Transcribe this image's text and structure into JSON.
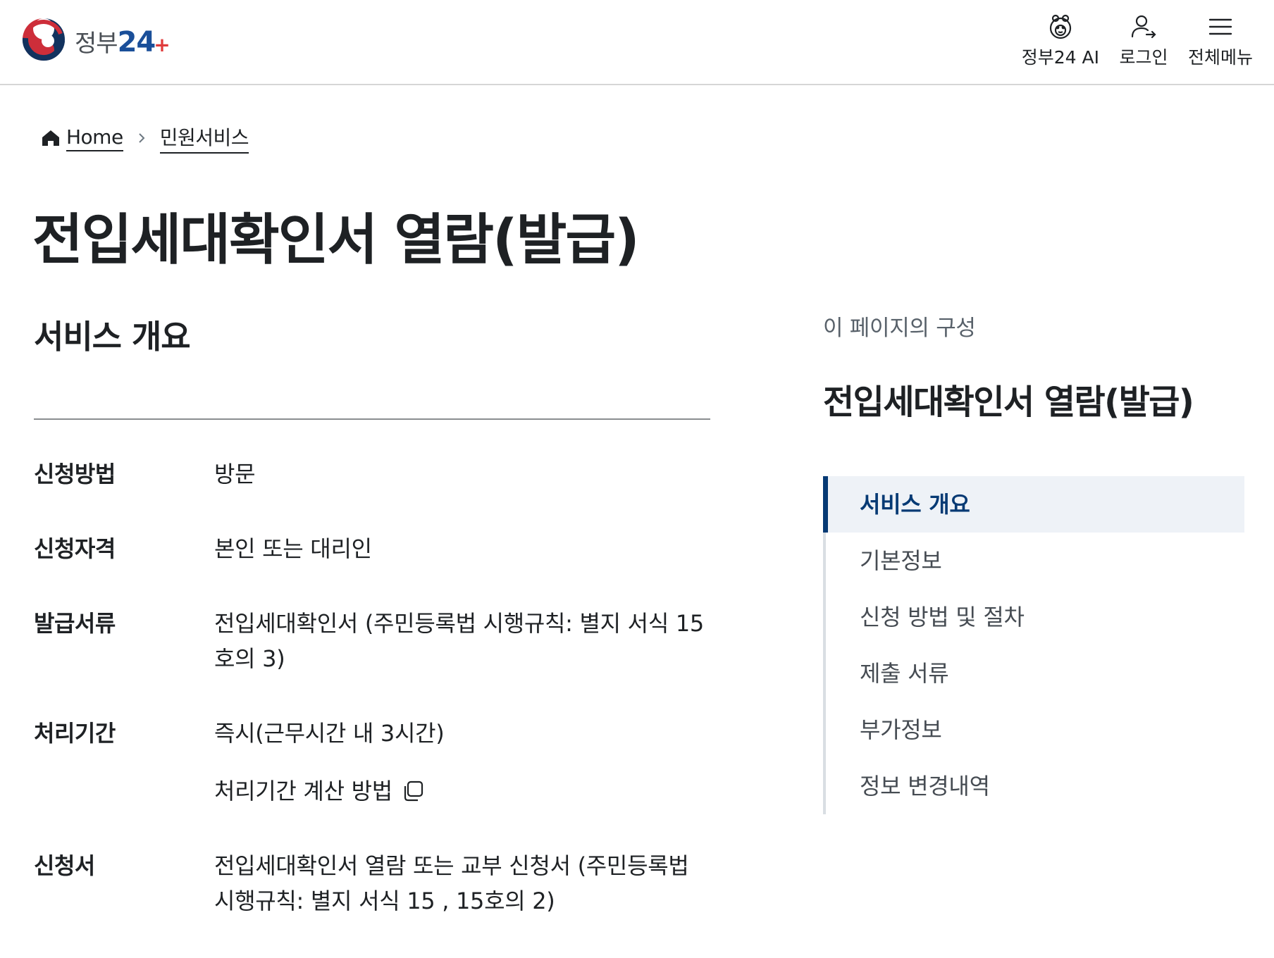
{
  "header": {
    "logo_text": "정부",
    "logo_number": "24",
    "logo_plus": "+",
    "nav": [
      {
        "label": "정부24 AI",
        "icon": "ai-mascot-icon"
      },
      {
        "label": "로그인",
        "icon": "login-user-icon"
      },
      {
        "label": "전체메뉴",
        "icon": "hamburger-menu-icon"
      }
    ]
  },
  "breadcrumb": {
    "home": "Home",
    "current": "민원서비스"
  },
  "page_title": "전입세대확인서 열람(발급)",
  "overview": {
    "section_title": "서비스 개요",
    "rows": [
      {
        "label": "신청방법",
        "value": "방문"
      },
      {
        "label": "신청자격",
        "value": "본인 또는 대리인"
      },
      {
        "label": "발급서류",
        "value": "전입세대확인서 (주민등록법 시행규칙: 별지 서식 15호의 3)"
      },
      {
        "label": "처리기간",
        "value": "즉시(근무시간 내 3시간)",
        "link": "처리기간 계산 방법"
      },
      {
        "label": "신청서",
        "value": "전입세대확인서 열람 또는 교부 신청서 (주민등록법 시행규칙: 별지 서식 15 , 15호의 2)"
      }
    ]
  },
  "toc": {
    "caption": "이 페이지의 구성",
    "title": "전입세대확인서 열람(발급)",
    "items": [
      {
        "label": "서비스 개요",
        "active": true
      },
      {
        "label": "기본정보",
        "active": false
      },
      {
        "label": "신청 방법 및 절차",
        "active": false
      },
      {
        "label": "제출 서류",
        "active": false
      },
      {
        "label": "부가정보",
        "active": false
      },
      {
        "label": "정보 변경내역",
        "active": false
      }
    ]
  },
  "colors": {
    "primary_navy": "#063a74",
    "toc_active_bg": "#eef2f7",
    "logo_blue": "#1a4f99",
    "logo_red": "#e03b3b"
  }
}
